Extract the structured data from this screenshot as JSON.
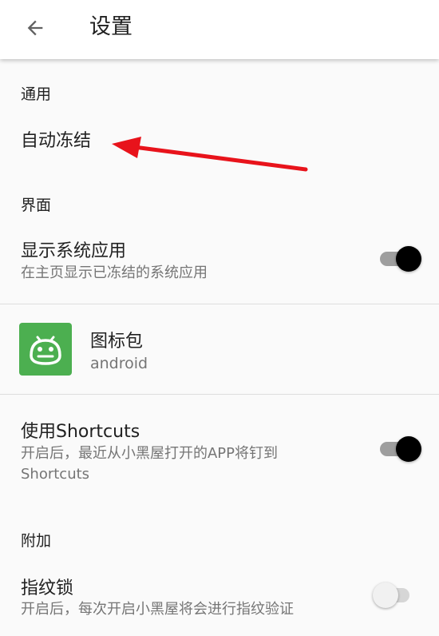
{
  "appbar": {
    "title": "设置",
    "back_icon": "arrow-left-icon"
  },
  "sections": {
    "general": {
      "header": "通用",
      "auto_freeze": {
        "title": "自动冻结"
      }
    },
    "interface": {
      "header": "界面",
      "show_system_apps": {
        "title": "显示系统应用",
        "summary": "在主页显示已冻结的系统应用",
        "enabled": true
      },
      "icon_pack": {
        "title": "图标包",
        "summary": "android",
        "icon": "android-robot-icon",
        "icon_color": "#4caf50"
      },
      "shortcuts": {
        "title": "使用Shortcuts",
        "summary": "开启后，最近从小黑屋打开的APP将钉到Shortcuts",
        "enabled": true
      }
    },
    "extra": {
      "header": "附加",
      "fingerprint_lock": {
        "title": "指纹锁",
        "summary": "开启后，每次开启小黑屋将会进行指纹验证",
        "enabled": false
      }
    }
  },
  "annotation": {
    "color": "#e8131b",
    "icon": "red-arrow-annotation"
  }
}
